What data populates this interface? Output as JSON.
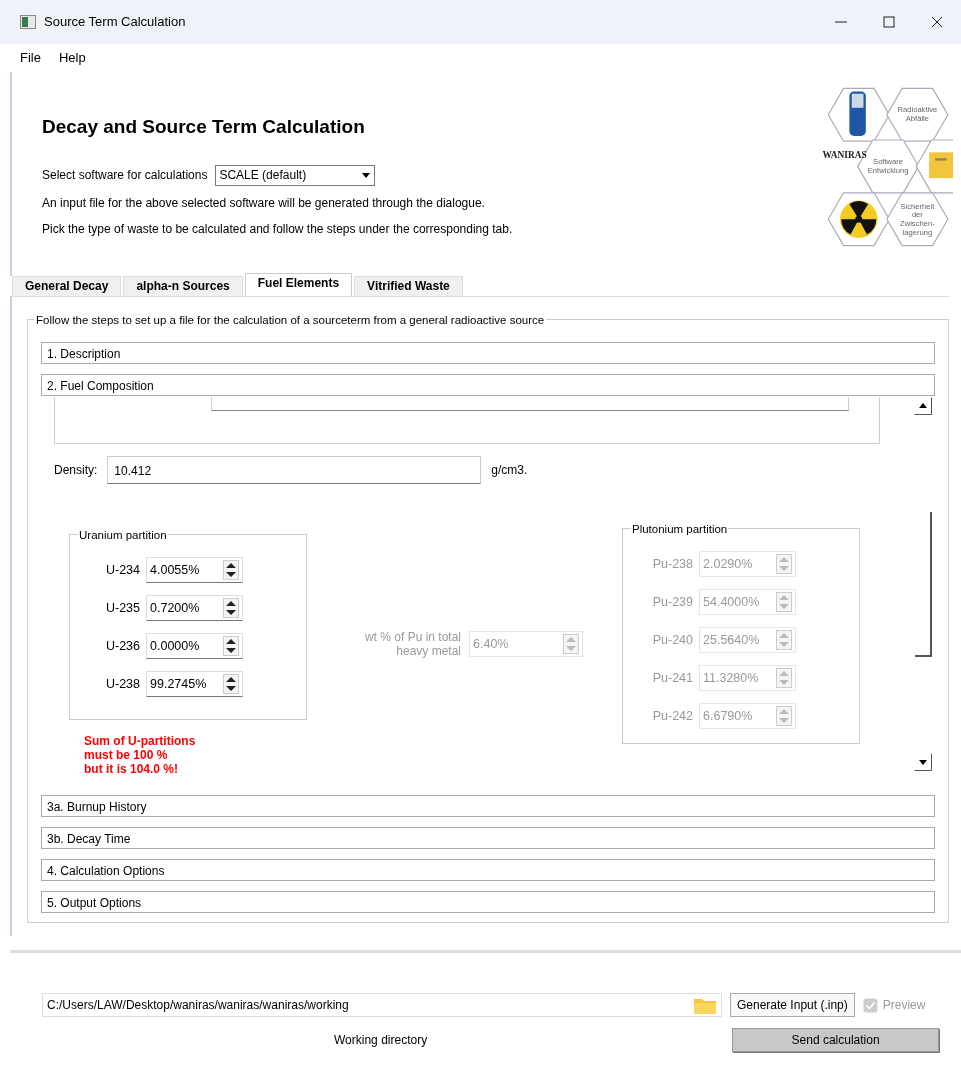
{
  "window": {
    "title": "Source Term Calculation"
  },
  "menu": [
    {
      "label": "File"
    },
    {
      "label": "Help"
    }
  ],
  "heading": "Decay and Source Term Calculation",
  "software": {
    "label": "Select software for calculations",
    "value": "SCALE (default)"
  },
  "info": [
    "An input file for the above selected software will be generated through the dialogue.",
    "Pick the type of waste to be calculated and follow the steps under the corresponding tab."
  ],
  "logo": {
    "brand": "WANIRAS",
    "labels": [
      "Radioaktive Abfälle",
      "Software Entwicklung",
      "Sicherheit der Zwischen- lagerung"
    ]
  },
  "tabs": [
    {
      "label": "General Decay",
      "selected": false
    },
    {
      "label": "alpha-n Sources",
      "selected": false
    },
    {
      "label": "Fuel Elements",
      "selected": true
    },
    {
      "label": "Vitrified Waste",
      "selected": false
    }
  ],
  "group_title": "Follow the steps to set up a file for the calculation of a sourceterm from a general radioactive source",
  "sections": [
    {
      "title": "1. Description"
    },
    {
      "title": "2. Fuel Composition",
      "composition": {
        "density": {
          "label": "Density:",
          "value": "10.412",
          "unit": "g/cm3."
        },
        "uranium": {
          "title": "Uranium partition",
          "rows": [
            {
              "label": "U-234",
              "value": "4.0055%",
              "disabled": false
            },
            {
              "label": "U-235",
              "value": "0.7200%",
              "disabled": false
            },
            {
              "label": "U-236",
              "value": "0.0000%",
              "disabled": false
            },
            {
              "label": "U-238",
              "value": "99.2745%",
              "disabled": false
            }
          ]
        },
        "pu_total": {
          "label": "wt % of Pu in total heavy metal",
          "value": "6.40%",
          "disabled": true
        },
        "plutonium": {
          "title": "Plutonium partition",
          "rows": [
            {
              "label": "Pu-238",
              "value": "2.0290%",
              "disabled": true
            },
            {
              "label": "Pu-239",
              "value": "54.4000%",
              "disabled": true
            },
            {
              "label": "Pu-240",
              "value": "25.5640%",
              "disabled": true
            },
            {
              "label": "Pu-241",
              "value": "11.3280%",
              "disabled": true
            },
            {
              "label": "Pu-242",
              "value": "6.6790%",
              "disabled": true
            }
          ]
        },
        "error": "Sum of U-partitions\nmust be 100 %\nbut it is 104.0 %!"
      }
    },
    {
      "title": "3a. Burnup History"
    },
    {
      "title": "3b. Decay Time"
    },
    {
      "title": "4. Calculation Options"
    },
    {
      "title": "5. Output Options"
    }
  ],
  "directory": {
    "value": "C:/Users/LAW/Desktop/waniras/waniras/waniras/working",
    "label": "Working directory"
  },
  "generate_button": "Generate Input (.inp)",
  "preview": {
    "label": "Preview",
    "checked": true,
    "disabled": true
  },
  "send_button": "Send calculation"
}
